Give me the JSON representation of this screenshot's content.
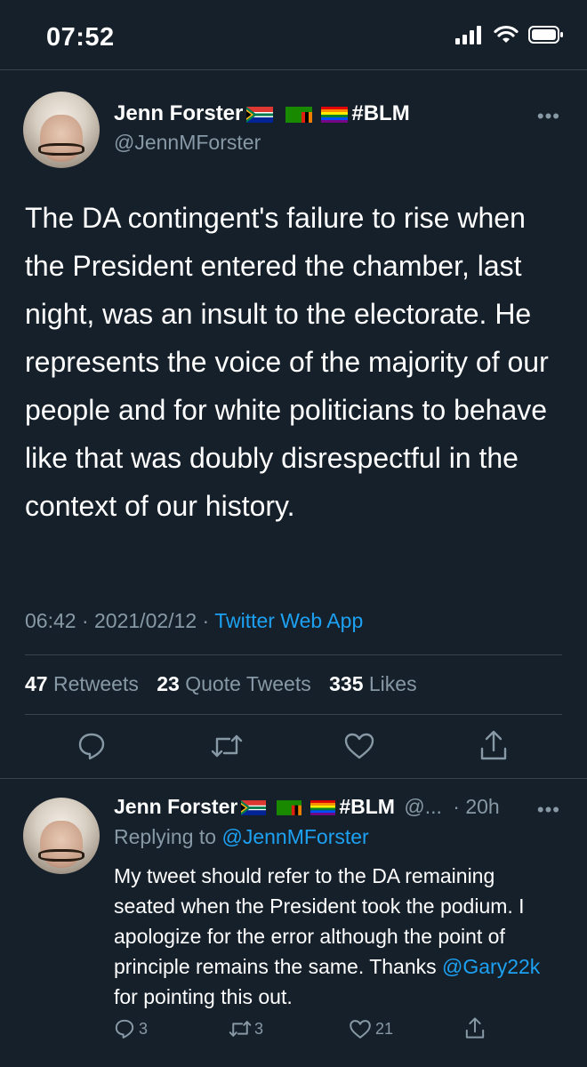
{
  "status_bar": {
    "time": "07:52"
  },
  "tweet": {
    "author_name": "Jenn Forster",
    "name_suffix": "#BLM",
    "handle": "@JennMForster",
    "text": "The DA contingent's failure to rise when the President entered the chamber, last night, was an insult to the electorate. He represents the voice of the majority of our people and for white politicians to behave like that was doubly disrespectful in the context of our history.",
    "time": "06:42",
    "date": "2021/02/12",
    "separator": "·",
    "source": "Twitter Web App",
    "retweets_count": "47",
    "retweets_label": "Retweets",
    "quote_count": "23",
    "quote_label": "Quote Tweets",
    "likes_count": "335",
    "likes_label": "Likes"
  },
  "reply": {
    "author_name": "Jenn Forster",
    "name_suffix": "#BLM",
    "handle_truncated": "@...",
    "age": "· 20h",
    "replying_label": "Replying to",
    "replying_to": "@JennMForster",
    "text_before": "My tweet should refer to the DA remaining seated when the President took the podium. I apologize for the error although the point of principle remains the same. Thanks ",
    "mention": "@Gary22k",
    "text_after": " for pointing this out.",
    "reply_count": "3",
    "retweet_count": "3",
    "like_count": "21"
  },
  "more_icon": "•••",
  "colors": {
    "background": "#15202b",
    "accent": "#1da1f2",
    "secondary": "#8899a6",
    "divider": "#38444d"
  }
}
